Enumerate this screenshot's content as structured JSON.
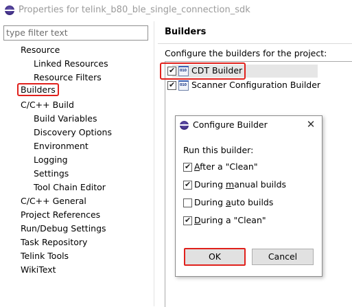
{
  "window": {
    "title": "Properties for telink_b80_ble_single_connection_sdk"
  },
  "filter": {
    "placeholder": "type filter text"
  },
  "tree": [
    {
      "label": "Resource",
      "level": 0
    },
    {
      "label": "Linked Resources",
      "level": 1
    },
    {
      "label": "Resource Filters",
      "level": 1
    },
    {
      "label": "Builders",
      "level": 0,
      "selected": true
    },
    {
      "label": "C/C++ Build",
      "level": 0
    },
    {
      "label": "Build Variables",
      "level": 1
    },
    {
      "label": "Discovery Options",
      "level": 1
    },
    {
      "label": "Environment",
      "level": 1
    },
    {
      "label": "Logging",
      "level": 1
    },
    {
      "label": "Settings",
      "level": 1
    },
    {
      "label": "Tool Chain Editor",
      "level": 1
    },
    {
      "label": "C/C++ General",
      "level": 0
    },
    {
      "label": "Project References",
      "level": 0
    },
    {
      "label": "Run/Debug Settings",
      "level": 0
    },
    {
      "label": "Task Repository",
      "level": 0
    },
    {
      "label": "Telink Tools",
      "level": 0
    },
    {
      "label": "WikiText",
      "level": 0
    }
  ],
  "page": {
    "title": "Builders",
    "description": "Configure the builders for the project:",
    "builders": [
      {
        "name": "CDT Builder",
        "checked": true,
        "selected": true,
        "icon": "builder-binary-icon"
      },
      {
        "name": "Scanner Configuration Builder",
        "checked": true,
        "selected": false,
        "icon": "builder-binary-icon"
      }
    ]
  },
  "dialog": {
    "title": "Configure Builder",
    "close": "✕",
    "prompt": "Run this builder:",
    "options": [
      {
        "pre": "",
        "ul": "A",
        "post": "fter a \"Clean\"",
        "checked": true
      },
      {
        "pre": "During ",
        "ul": "m",
        "post": "anual builds",
        "checked": true
      },
      {
        "pre": "During ",
        "ul": "a",
        "post": "uto builds",
        "checked": false
      },
      {
        "pre": "",
        "ul": "D",
        "post": "uring a \"Clean\"",
        "checked": true
      }
    ],
    "ok_label": "OK",
    "cancel_label": "Cancel"
  },
  "icon_bits": "010",
  "colors": {
    "highlight_border": "#e0201b",
    "selection": "#e6e6e6"
  }
}
